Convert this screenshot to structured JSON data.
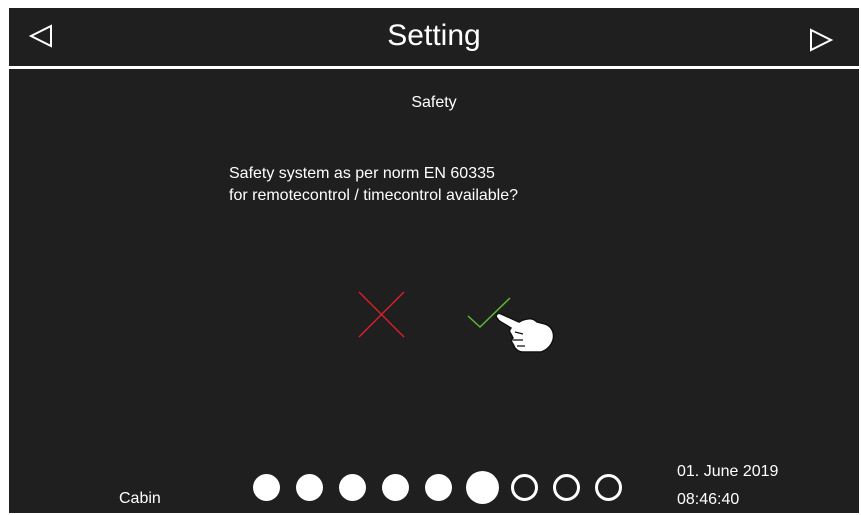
{
  "header": {
    "title": "Setting",
    "prev_icon": "triangle-left-icon",
    "next_icon": "triangle-right-icon"
  },
  "main": {
    "section_title": "Safety",
    "question_lines": [
      "Safety system as per norm EN 60335",
      "for remotecontrol / timecontrol available?"
    ],
    "options": [
      {
        "icon": "cross-icon",
        "color": "#d8202a"
      },
      {
        "icon": "checkmark-icon",
        "color": "#5ab834"
      }
    ]
  },
  "footer": {
    "label": "Cabin",
    "progress": {
      "total": 9,
      "completed": 5,
      "current": 6
    },
    "date": "01. June 2019",
    "time": "08:46:40"
  },
  "colors": {
    "background": "#1f1f1f",
    "text": "#ffffff",
    "no": "#d8202a",
    "yes": "#5ab834"
  }
}
